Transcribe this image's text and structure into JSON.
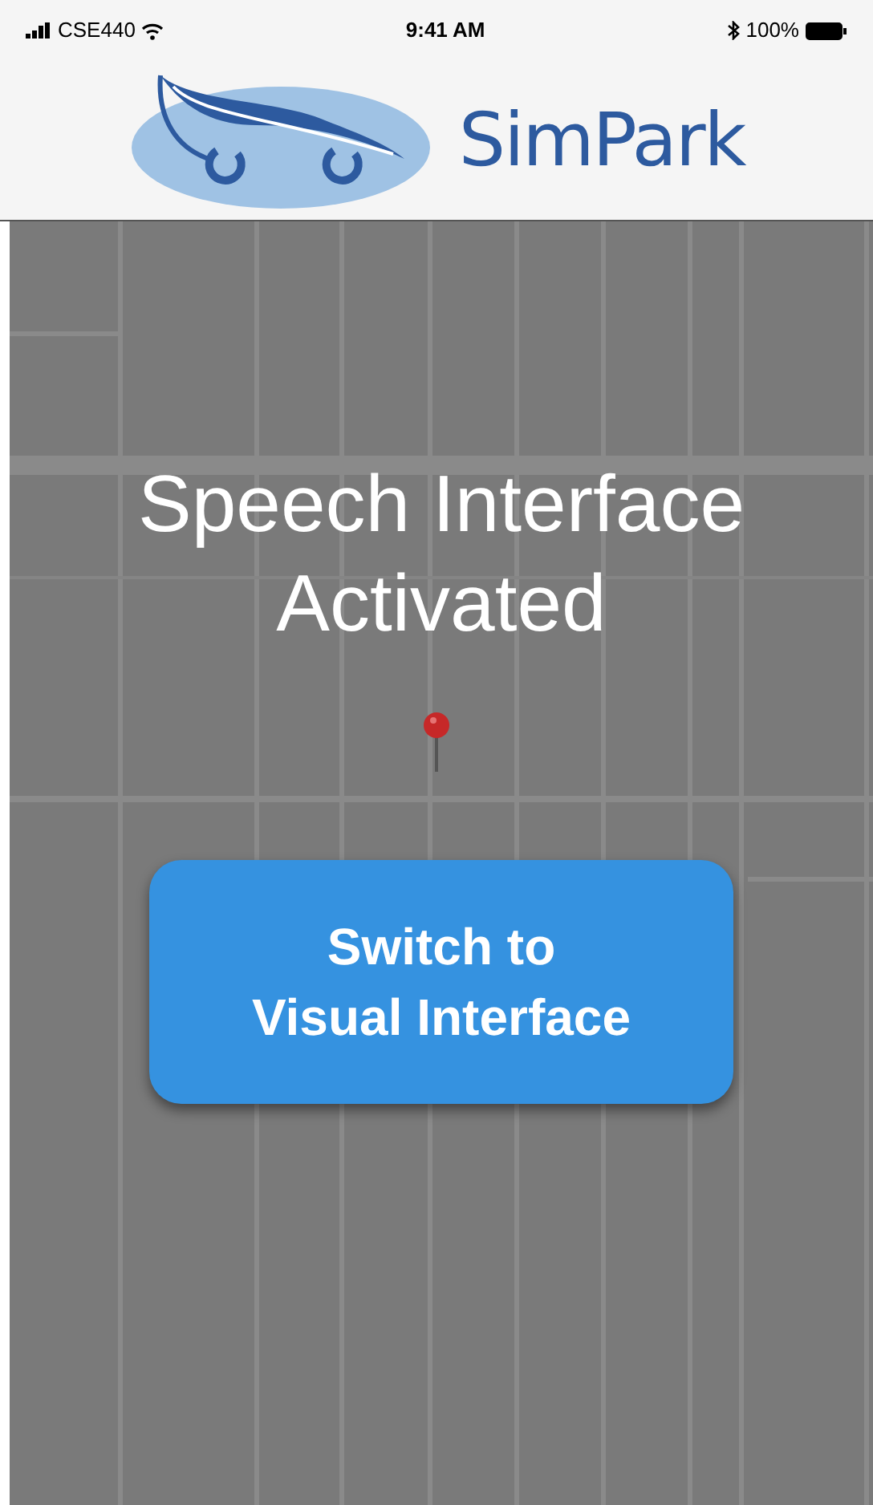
{
  "status_bar": {
    "carrier": "CSE440",
    "time": "9:41 AM",
    "battery": "100%"
  },
  "header": {
    "app_name": "SimPark"
  },
  "overlay": {
    "message": "Speech Interface Activated",
    "button_lines": [
      "Switch to",
      "Visual Interface"
    ]
  }
}
